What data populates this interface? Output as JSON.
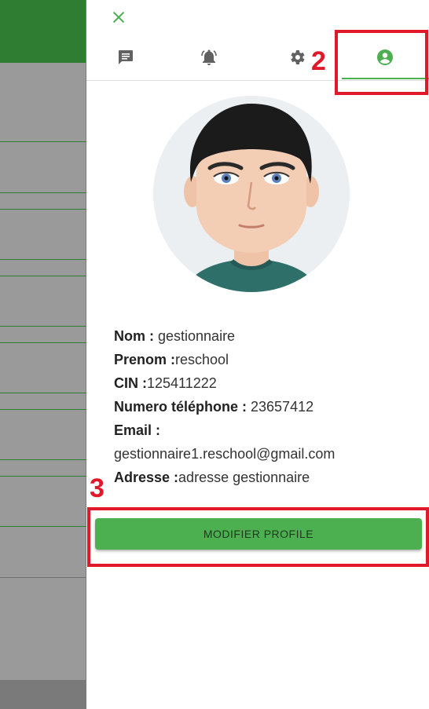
{
  "colors": {
    "accent": "#4caf50",
    "header_green": "#2e7d32",
    "annotation_red": "#e0192a",
    "overlay_gray": "#9a9a9a"
  },
  "drawer": {
    "close_icon": "close-icon",
    "tabs": [
      {
        "name": "messages",
        "icon": "chat-icon"
      },
      {
        "name": "notifications",
        "icon": "bell-icon"
      },
      {
        "name": "settings",
        "icon": "gear-icon"
      },
      {
        "name": "profile",
        "icon": "account-circle-icon",
        "active": true
      }
    ],
    "annotations": {
      "tab_marker": "2",
      "button_marker": "3"
    },
    "profile": {
      "nom_label": "Nom : ",
      "nom_value": "gestionnaire",
      "prenom_label": "Prenom :",
      "prenom_value": "reschool",
      "cin_label": "CIN :",
      "cin_value": "125411222",
      "tel_label": "Numero téléphone : ",
      "tel_value": "23657412",
      "email_label": "Email :",
      "email_value": "gestionnaire1.reschool@gmail.com",
      "adresse_label": "Adresse :",
      "adresse_value": "adresse gestionnaire"
    },
    "modify_button_label": "MODIFIER PROFILE"
  }
}
